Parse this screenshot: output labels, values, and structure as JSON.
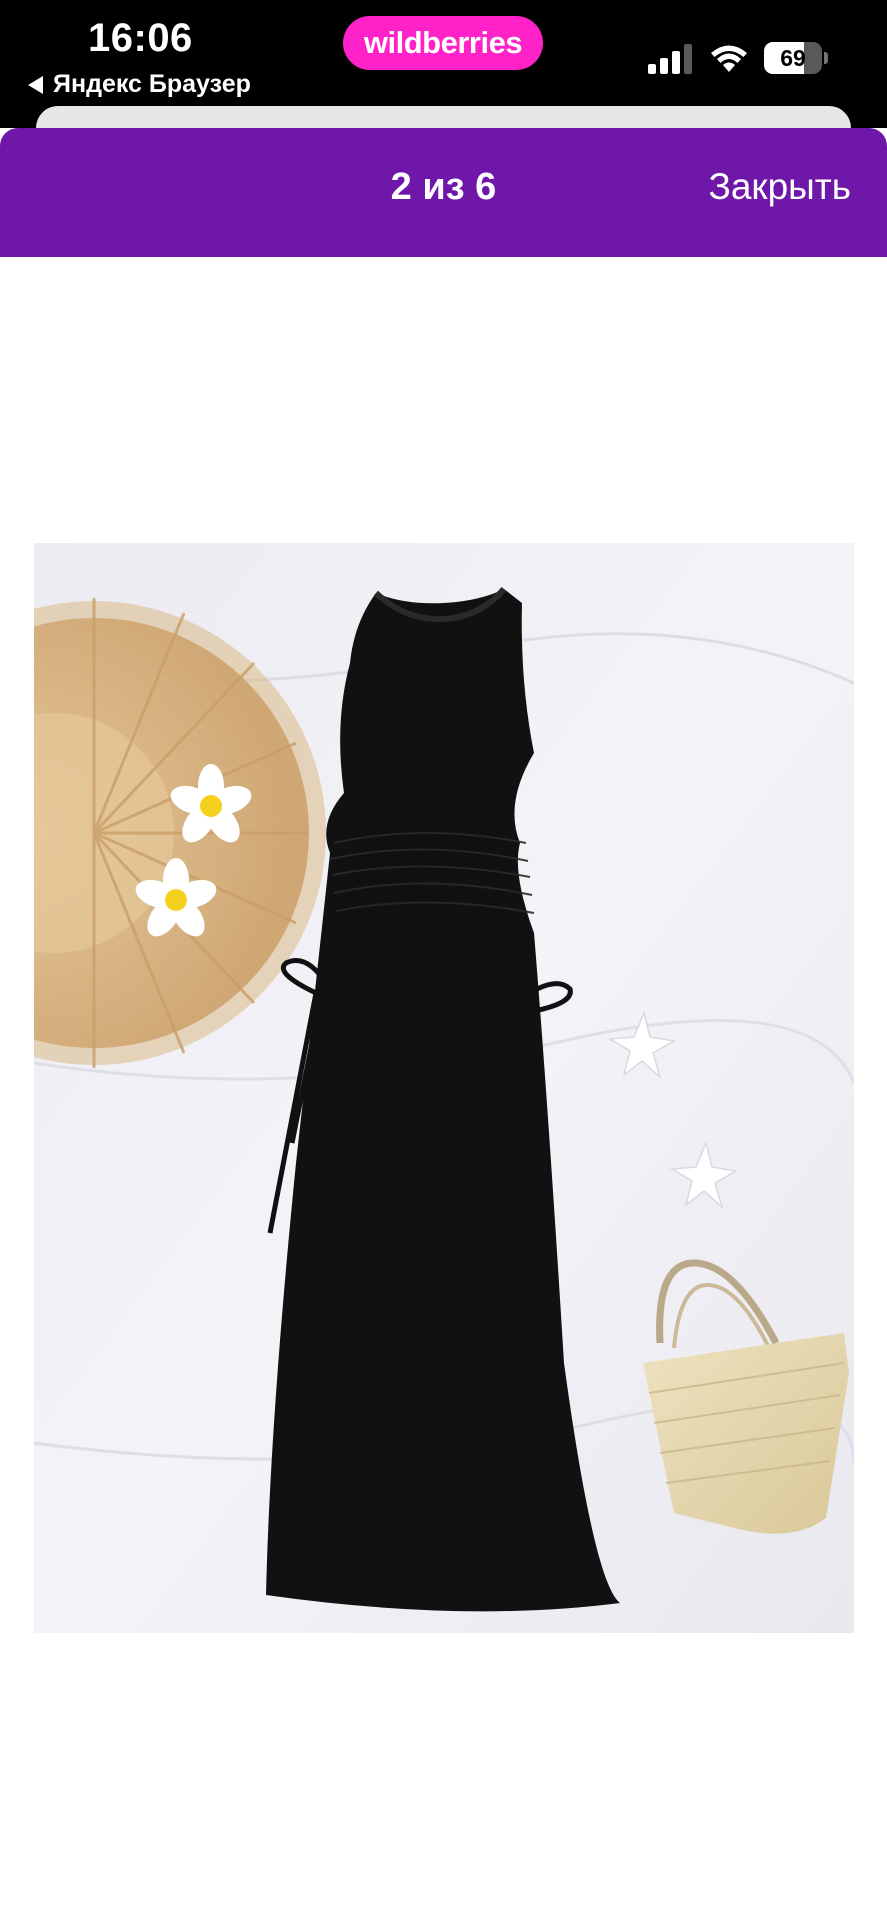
{
  "status_bar": {
    "time": "16:06",
    "back_app": "Яндекс Браузер",
    "battery_level": "69",
    "battery_fraction": 0.69
  },
  "brand": {
    "name": "wildberries",
    "color": "#ff22c8"
  },
  "gallery": {
    "counter": "2 из 6",
    "close_label": "Закрыть",
    "header_color": "#6e17a9"
  },
  "photo": {
    "subject": "black mesh sleeveless maxi dress with side drawstrings",
    "props": [
      "straw hat",
      "plumeria flowers",
      "starfish",
      "straw bag"
    ]
  }
}
